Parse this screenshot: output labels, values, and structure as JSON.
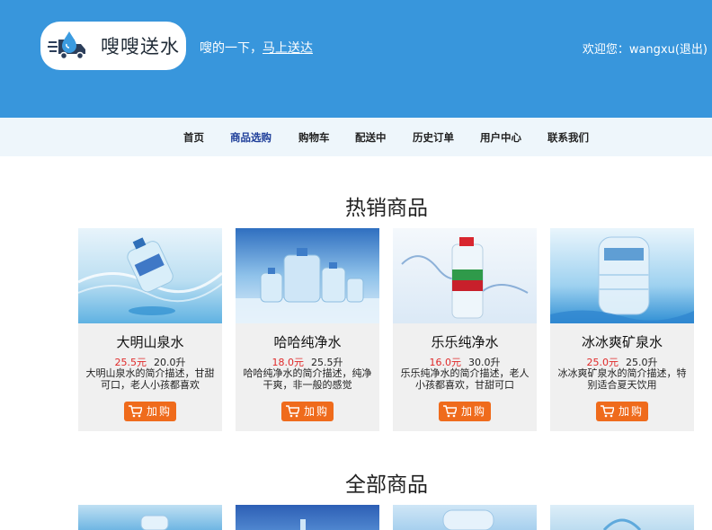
{
  "header": {
    "logo_text": "嗖嗖送水",
    "slogan": "嗖的一下，",
    "slogan_link": "马上送达",
    "welcome": "欢迎您：wangxu(退出)"
  },
  "nav": {
    "items": [
      {
        "label": "首页",
        "active": false
      },
      {
        "label": "商品选购",
        "active": true
      },
      {
        "label": "购物车",
        "active": false
      },
      {
        "label": "配送中",
        "active": false
      },
      {
        "label": "历史订单",
        "active": false
      },
      {
        "label": "用户中心",
        "active": false
      },
      {
        "label": "联系我们",
        "active": false
      }
    ]
  },
  "hot": {
    "title": "热销商品",
    "products": [
      {
        "name": "大明山泉水",
        "price": "25.5元",
        "volume": "20.0升",
        "desc": "大明山泉水的简介描述，甘甜可口，老人小孩都喜欢",
        "buy": "加购"
      },
      {
        "name": "哈哈纯净水",
        "price": "18.0元",
        "volume": "25.5升",
        "desc": "哈哈纯净水的简介描述，纯净干爽，非一般的感觉",
        "buy": "加购"
      },
      {
        "name": "乐乐纯净水",
        "price": "16.0元",
        "volume": "30.0升",
        "desc": "乐乐纯净水的简介描述，老人小孩都喜欢，甘甜可口",
        "buy": "加购"
      },
      {
        "name": "冰冰爽矿泉水",
        "price": "25.0元",
        "volume": "25.0升",
        "desc": "冰冰爽矿泉水的简介描述，特别适合夏天饮用",
        "buy": "加购"
      }
    ]
  },
  "all": {
    "title": "全部商品"
  },
  "colors": {
    "header_bg": "#3896dc",
    "nav_bg": "#eef6fb",
    "price": "#e02a2a",
    "buy_button": "#ef6b1c",
    "active_nav": "#1f3f9a"
  },
  "icons": [
    "water-delivery-logo-icon",
    "cart-icon"
  ]
}
